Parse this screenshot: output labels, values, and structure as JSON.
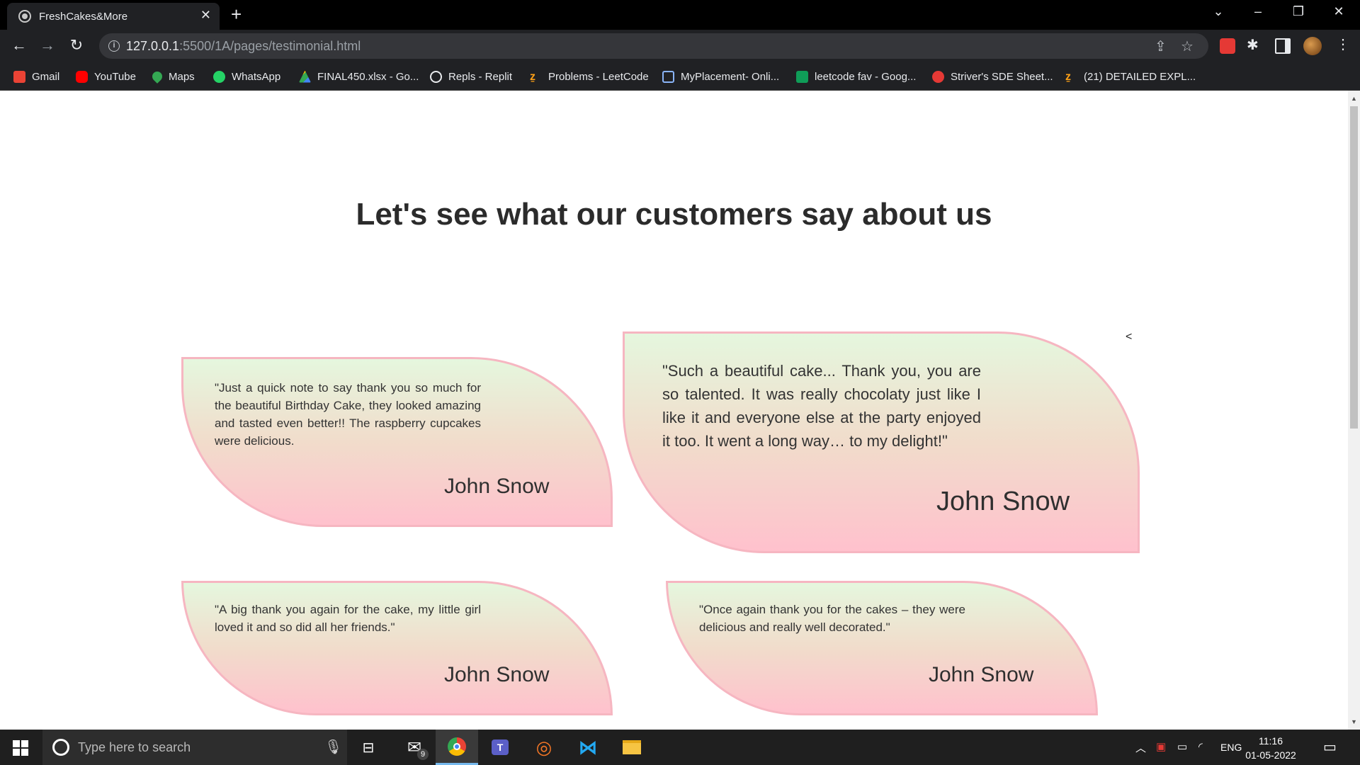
{
  "browser": {
    "tab_title": "FreshCakes&More",
    "url_host": "127.0.0.1",
    "url_rest": ":5500/1A/pages/testimonial.html",
    "bookmarks": [
      {
        "label": "Gmail",
        "icon": "gmail-icon",
        "color": "#ea4335"
      },
      {
        "label": "YouTube",
        "icon": "youtube-icon",
        "color": "#ff0000"
      },
      {
        "label": "Maps",
        "icon": "maps-icon",
        "color": "#34a853"
      },
      {
        "label": "WhatsApp",
        "icon": "whatsapp-icon",
        "color": "#25d366"
      },
      {
        "label": "FINAL450.xlsx - Go...",
        "icon": "drive-icon",
        "color": "#fbbc04"
      },
      {
        "label": "Repls - Replit",
        "icon": "replit-icon",
        "color": "#e8eaed"
      },
      {
        "label": "Problems - LeetCode",
        "icon": "leetcode-icon",
        "color": "#ffa116"
      },
      {
        "label": "MyPlacement- Onli...",
        "icon": "external-link-icon",
        "color": "#8ab4f8"
      },
      {
        "label": "leetcode fav - Goog...",
        "icon": "sheets-icon",
        "color": "#0f9d58"
      },
      {
        "label": "Striver's SDE Sheet...",
        "icon": "tuf-icon",
        "color": "#e53935"
      },
      {
        "label": "(21) DETAILED EXPL...",
        "icon": "leetcode-icon",
        "color": "#ffa116"
      }
    ]
  },
  "page": {
    "heading": "Let's see what our customers say about us",
    "prev_arrow": "<",
    "testimonials": [
      {
        "quote": "\"Just a quick note to say thank you so much for the beautiful Birthday Cake, they looked amazing and tasted even better!! The raspberry cupcakes were delicious.",
        "author": "John Snow"
      },
      {
        "quote": "\"Such a beautiful cake... Thank you, you are so talented. It was really chocolaty just like I like it and everyone else at the party enjoyed it too. It went a long way… to my delight!\"",
        "author": "John Snow"
      },
      {
        "quote": "\"A big thank you again for the cake, my little girl loved it and so did all her friends.\"",
        "author": "John Snow"
      },
      {
        "quote": "\"Once again thank you for the cakes – they were delicious and really well decorated.\"",
        "author": "John Snow"
      }
    ]
  },
  "taskbar": {
    "search_placeholder": "Type here to search",
    "mail_badge": "9",
    "language": "ENG",
    "time": "11:16",
    "date": "01-05-2022"
  }
}
